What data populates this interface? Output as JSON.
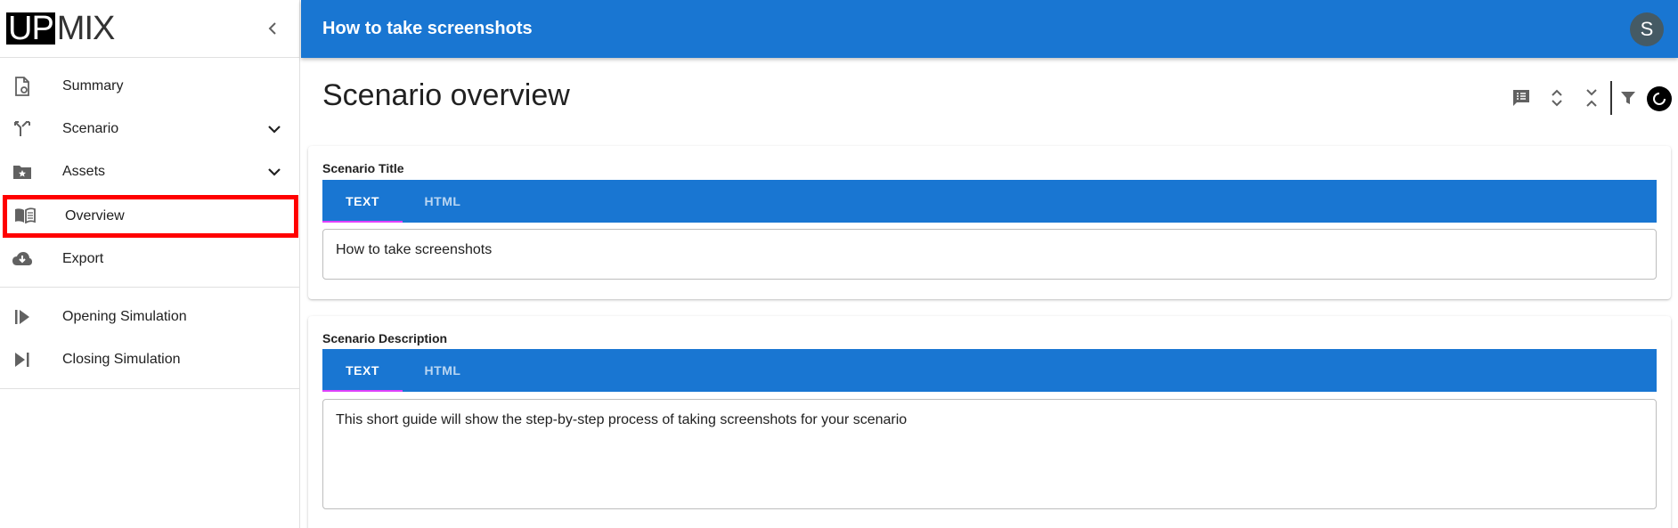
{
  "app": {
    "logo_left": "UP",
    "logo_right": "MIX"
  },
  "sidebar": {
    "items": [
      {
        "label": "Summary",
        "icon": "file-settings-icon"
      },
      {
        "label": "Scenario",
        "icon": "call-split-icon",
        "expandable": true
      },
      {
        "label": "Assets",
        "icon": "folder-star-icon",
        "expandable": true
      },
      {
        "label": "Overview",
        "icon": "book-open-icon",
        "highlighted": true
      },
      {
        "label": "Export",
        "icon": "cloud-download-icon"
      },
      {
        "label": "Opening Simulation",
        "icon": "play-start-icon"
      },
      {
        "label": "Closing Simulation",
        "icon": "skip-next-icon"
      }
    ]
  },
  "topbar": {
    "title": "How to take screenshots",
    "avatar_initial": "S"
  },
  "main": {
    "page_title": "Scenario overview",
    "toolbar": [
      "comment-list-icon",
      "expand-icon",
      "collapse-icon",
      "filter-icon",
      "loading-icon"
    ],
    "sections": [
      {
        "label": "Scenario Title",
        "tabs": [
          "TEXT",
          "HTML"
        ],
        "active_tab": "TEXT",
        "value": "How to take screenshots"
      },
      {
        "label": "Scenario Description",
        "tabs": [
          "TEXT",
          "HTML"
        ],
        "active_tab": "TEXT",
        "value": "This short guide will show the step-by-step process of taking screenshots for your scenario"
      }
    ]
  },
  "colors": {
    "primary": "#1976d2",
    "highlight_border": "#ff0000",
    "tab_indicator": "#e040fb",
    "avatar_bg": "#455a64"
  }
}
